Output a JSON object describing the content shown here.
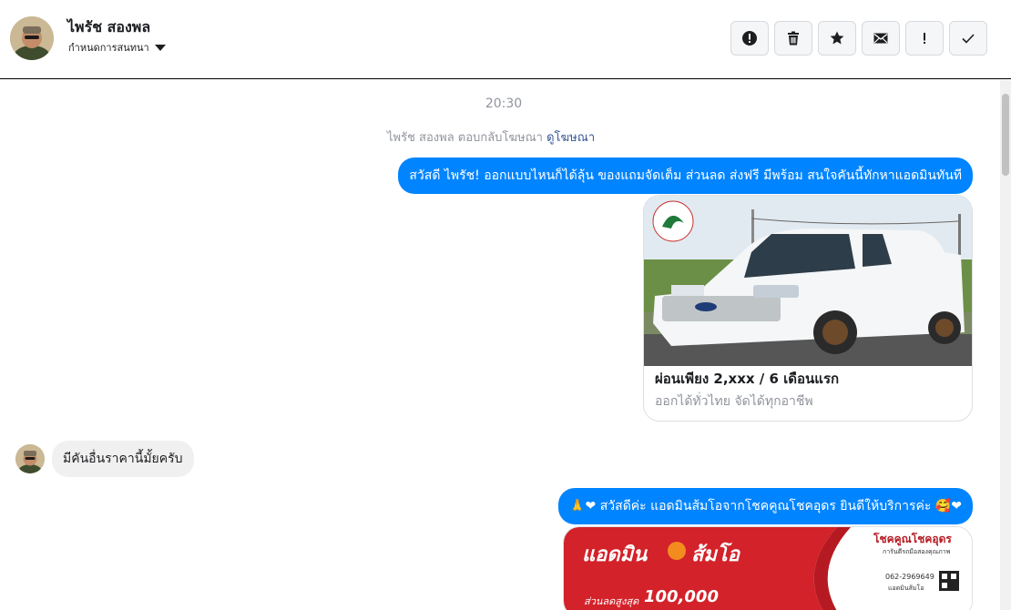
{
  "header": {
    "contact_name": "ไพรัช สองพล",
    "assign_label": "กำหนดการสนทนา",
    "toolbar": [
      {
        "name": "spam",
        "icon": "alert-circle-icon"
      },
      {
        "name": "delete",
        "icon": "trash-icon"
      },
      {
        "name": "star",
        "icon": "star-icon"
      },
      {
        "name": "mark-unread",
        "icon": "envelope-icon"
      },
      {
        "name": "important",
        "icon": "exclamation-icon"
      },
      {
        "name": "done",
        "icon": "check-icon"
      }
    ]
  },
  "thread": {
    "timestamp": "20:30",
    "ad_reply_text": "ไพรัช สองพล ตอบกลับโฆษณา",
    "ad_reply_link": "ดูโฆษณา",
    "messages": [
      {
        "from": "page",
        "text": "สวัสดี ไพรัช! ออกแบบไหนก็ได้ลุ้น ของแถมจัดเต็ม ส่วนลด ส่งฟรี มีพร้อม สนใจคันนี้ทักหาแอดมินทันที"
      },
      {
        "from": "page",
        "card_title": "ผ่อนเพียง 2,xxx / 6 เดือนแรก",
        "card_subtitle": "ออกได้ทั่วไทย จัดได้ทุกอาชีพ"
      },
      {
        "from": "user",
        "text": "มีคันอื่นราคานี้มั้ยครับ"
      },
      {
        "from": "page",
        "text_prefix": "🙏❤",
        "text": "สวัสดีค่ะ แอดมินส้มโอจากโชคคูณโชคอุดร ยินดีให้บริการค่ะ",
        "text_suffix": "🥰❤"
      }
    ],
    "banner": {
      "brand_left": "แอดมิน",
      "brand_right": "ส้มโอ",
      "discount_label": "ส่วนลดสูงสุด",
      "discount_value": "100,000",
      "shop_name": "โชคคูณโชคอุดร",
      "shop_tagline": "การันตีรถมือสองคุณภาพ",
      "phone": "062-2969649",
      "qr_caption": "แอดมินส้มโอ"
    }
  },
  "colors": {
    "accent": "#0084ff",
    "incoming_bubble": "#f1f0f0",
    "banner_red": "#d3222a"
  }
}
